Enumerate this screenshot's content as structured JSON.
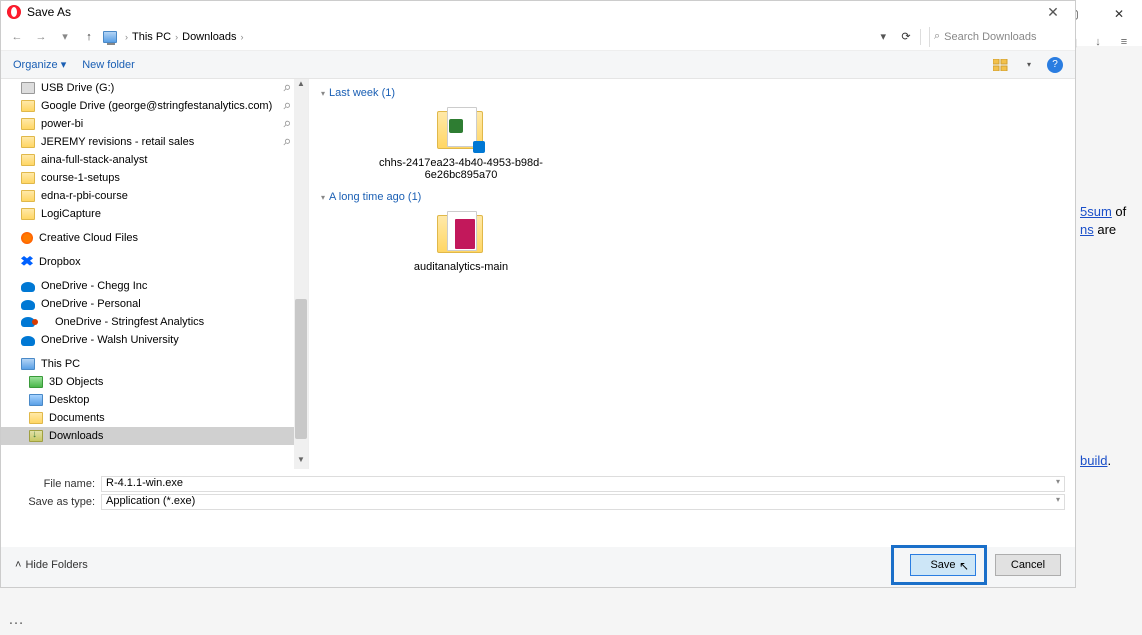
{
  "titlebar": {
    "title": "Save As",
    "close": "✕"
  },
  "nav": {
    "back": "←",
    "forward": "→",
    "dropdown": "▾",
    "up": "↑",
    "crumbs": [
      "This PC",
      "Downloads"
    ],
    "sep": "›",
    "crumb_dd": "▾",
    "refresh": "⟳",
    "search_icon": "⌕",
    "search_placeholder": "Search Downloads"
  },
  "toolbar": {
    "organize": "Organize ▾",
    "new_folder": "New folder",
    "help": "?"
  },
  "tree": {
    "items": [
      {
        "label": "USB Drive (G:)",
        "icon": "usb",
        "pin": true
      },
      {
        "label": "Google Drive (george@stringfestanalytics.com)",
        "icon": "folder",
        "pin": true
      },
      {
        "label": "power-bi",
        "icon": "folder",
        "pin": true
      },
      {
        "label": "JEREMY revisions - retail sales",
        "icon": "folder",
        "pin": true
      },
      {
        "label": "aina-full-stack-analyst",
        "icon": "folder"
      },
      {
        "label": "course-1-setups",
        "icon": "folder"
      },
      {
        "label": "edna-r-pbi-course",
        "icon": "folder"
      },
      {
        "label": "LogiCapture",
        "icon": "folder"
      },
      {
        "label": "Creative Cloud Files",
        "icon": "cc"
      },
      {
        "label": "Dropbox",
        "icon": "dropbox"
      },
      {
        "label": "OneDrive - Chegg Inc",
        "icon": "onedrive"
      },
      {
        "label": "OneDrive - Personal",
        "icon": "onedrive"
      },
      {
        "label": "OneDrive - Stringfest Analytics",
        "icon": "odred"
      },
      {
        "label": "OneDrive - Walsh University",
        "icon": "onedrive"
      },
      {
        "label": "This PC",
        "icon": "pc"
      },
      {
        "label": "3D Objects",
        "icon": "green",
        "indent": true
      },
      {
        "label": "Desktop",
        "icon": "blue",
        "indent": true
      },
      {
        "label": "Documents",
        "icon": "folder",
        "indent": true
      },
      {
        "label": "Downloads",
        "icon": "downl",
        "indent": true,
        "selected": true
      }
    ]
  },
  "content": {
    "groups": [
      {
        "header": "Last week (1)",
        "items": [
          {
            "name": "chhs-2417ea23-4b40-4953-b98d-6e26bc895a70",
            "thumb": "zip-green"
          }
        ]
      },
      {
        "header": "A long time ago (1)",
        "items": [
          {
            "name": "auditanalytics-main",
            "thumb": "zip-pink"
          }
        ]
      }
    ]
  },
  "fields": {
    "filename_label": "File name:",
    "filename_value": "R-4.1.1-win.exe",
    "savetype_label": "Save as type:",
    "savetype_value": "Application (*.exe)"
  },
  "bottom": {
    "hide_folders": "Hide Folders",
    "save": "Save",
    "cancel": "Cancel"
  },
  "behind": {
    "min": "—",
    "max": "▢",
    "close": "✕",
    "cube": "◫",
    "download": "↓",
    "menu": "≡",
    "frag1a": "5sum",
    "frag1b": " of",
    "frag2a": "ns",
    "frag2b": " are",
    "frag3a": "build",
    "frag3b": "."
  }
}
